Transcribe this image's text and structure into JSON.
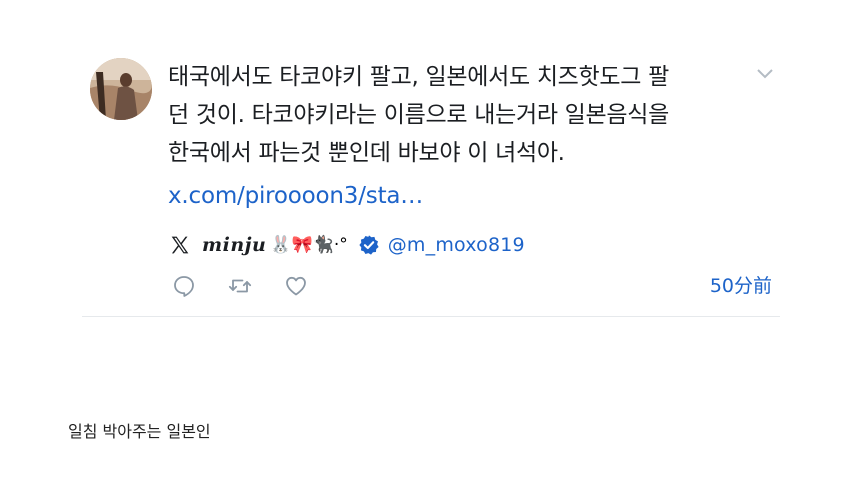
{
  "tweet": {
    "text": "태국에서도 타코야키 팔고, 일본에서도 치즈핫도그 팔\n던 것이. 타코야키라는 이름으로 내는거라 일본음식을\n한국에서 파는것 뿐인데 바보야 이 녀석아.",
    "link": "x.com/piroooon3/sta…",
    "author": {
      "display_name": "minju",
      "display_emojis": "🐰🎀🐈‍⬛·°",
      "handle": "@m_moxo819"
    },
    "timestamp": "50分前"
  },
  "icons": {
    "platform": "x-logo-icon",
    "verified": "verified-badge-icon",
    "reply": "reply-icon",
    "retweet": "retweet-icon",
    "like": "heart-icon",
    "menu": "chevron-down-icon"
  },
  "colors": {
    "link": "#1d63c9",
    "verified": "#1d63c9",
    "text": "#1b1e22",
    "icon_gray": "#8b98a5"
  },
  "caption": "일침 박아주는 일본인"
}
